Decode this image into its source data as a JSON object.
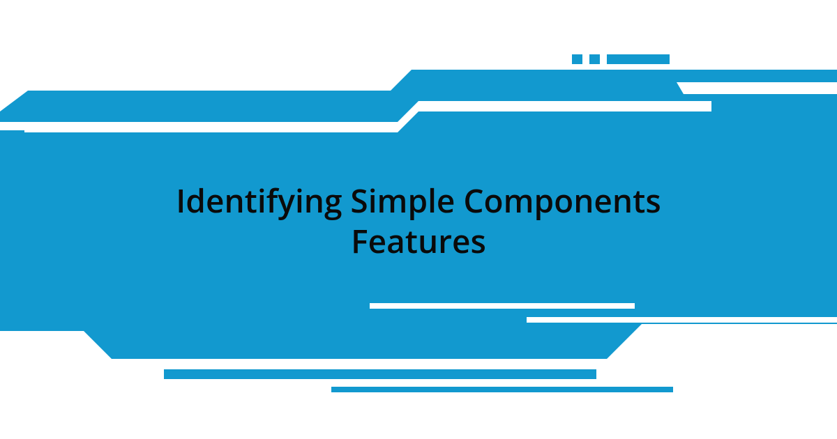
{
  "title_line1": "Identifying Simple Components",
  "title_line2": "Features",
  "colors": {
    "accent": "#1299cf",
    "text": "#0a0a0a",
    "background": "#ffffff"
  }
}
